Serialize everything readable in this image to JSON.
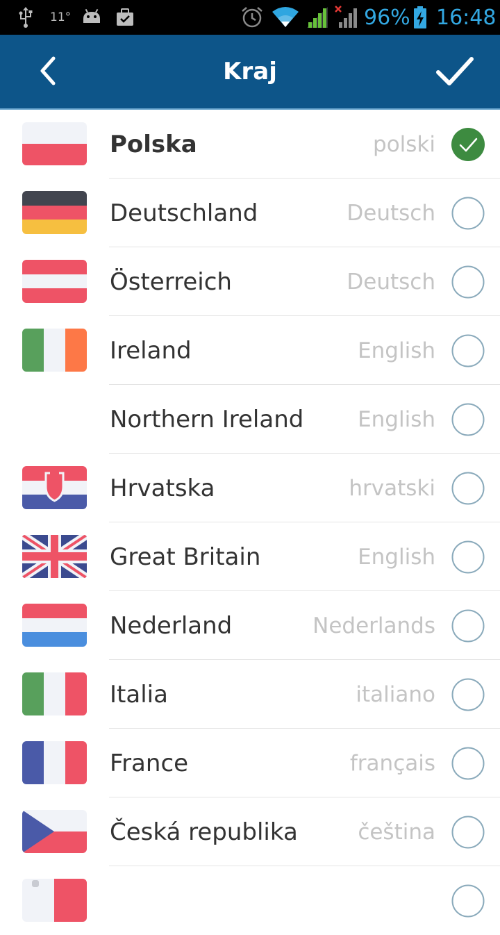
{
  "status_bar": {
    "icons": [
      "usb-icon",
      "android-icon",
      "briefcase-icon",
      "alarm-icon",
      "wifi-icon",
      "signal-icon",
      "signal-no-data-icon",
      "battery-charging-icon"
    ],
    "temperature": "11°",
    "battery": "96%",
    "time": "16:48",
    "accent_color": "#33a8e2"
  },
  "app_bar": {
    "title": "Kraj",
    "back_icon": "chevron-left-icon",
    "confirm_icon": "check-icon",
    "background": "#0d5589"
  },
  "countries": [
    {
      "name": "Polska",
      "language": "polski",
      "selected": true,
      "flag": "poland-flag-icon"
    },
    {
      "name": "Deutschland",
      "language": "Deutsch",
      "selected": false,
      "flag": "germany-flag-icon"
    },
    {
      "name": "Österreich",
      "language": "Deutsch",
      "selected": false,
      "flag": "austria-flag-icon"
    },
    {
      "name": "Ireland",
      "language": "English",
      "selected": false,
      "flag": "ireland-flag-icon"
    },
    {
      "name": "Northern Ireland",
      "language": "English",
      "selected": false,
      "flag": ""
    },
    {
      "name": "Hrvatska",
      "language": "hrvatski",
      "selected": false,
      "flag": "croatia-flag-icon"
    },
    {
      "name": "Great Britain",
      "language": "English",
      "selected": false,
      "flag": "uk-flag-icon"
    },
    {
      "name": "Nederland",
      "language": "Nederlands",
      "selected": false,
      "flag": "netherlands-flag-icon"
    },
    {
      "name": "Italia",
      "language": "italiano",
      "selected": false,
      "flag": "italy-flag-icon"
    },
    {
      "name": "France",
      "language": "français",
      "selected": false,
      "flag": "france-flag-icon"
    },
    {
      "name": "Česká republika",
      "language": "čeština",
      "selected": false,
      "flag": "czech-flag-icon"
    },
    {
      "name": "",
      "language": "",
      "selected": false,
      "flag": "partial-flag-icon"
    }
  ],
  "colors": {
    "selected_check": "#3d8b40",
    "radio_border": "#8aaabb",
    "language_text": "#c4c4c4",
    "name_text": "#333333"
  }
}
